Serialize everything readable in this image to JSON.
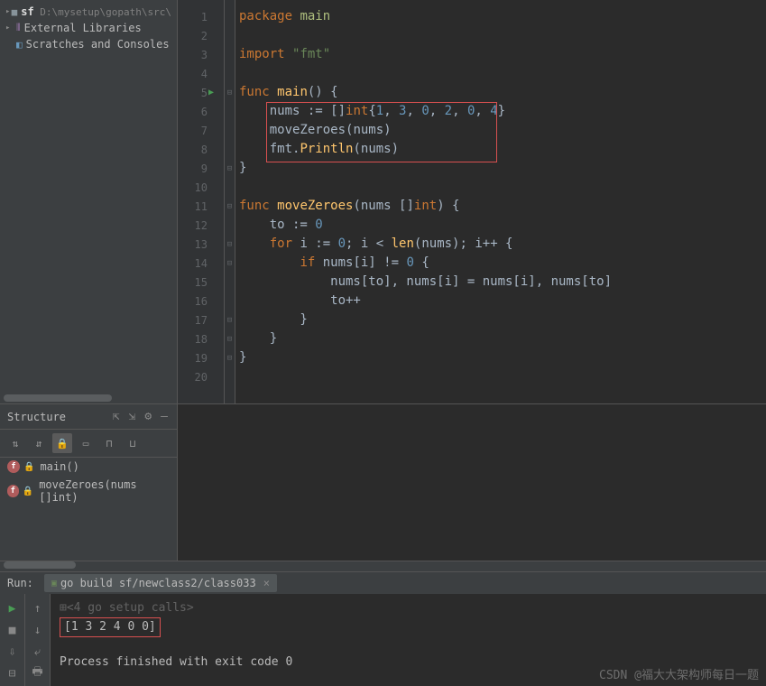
{
  "sidebar": {
    "folder": {
      "name": "sf",
      "path": "D:\\mysetup\\gopath\\src\\"
    },
    "libs": "External Libraries",
    "scratches": "Scratches and Consoles"
  },
  "code": {
    "lines": [
      {
        "n": 1,
        "segs": [
          [
            "kw",
            "package "
          ],
          [
            "pkg",
            "main"
          ]
        ]
      },
      {
        "n": 2,
        "segs": []
      },
      {
        "n": 3,
        "segs": [
          [
            "kw",
            "import "
          ],
          [
            "str",
            "\"fmt\""
          ]
        ]
      },
      {
        "n": 4,
        "segs": []
      },
      {
        "n": 5,
        "run": true,
        "fold": "⊟",
        "segs": [
          [
            "kw",
            "func "
          ],
          [
            "fn",
            "main"
          ],
          [
            "var",
            "() {"
          ]
        ]
      },
      {
        "n": 6,
        "segs": [
          [
            "var",
            "    nums := []"
          ],
          [
            "typ",
            "int"
          ],
          [
            "var",
            "{"
          ],
          [
            "num",
            "1"
          ],
          [
            "var",
            ", "
          ],
          [
            "num",
            "3"
          ],
          [
            "var",
            ", "
          ],
          [
            "num",
            "0"
          ],
          [
            "var",
            ", "
          ],
          [
            "num",
            "2"
          ],
          [
            "var",
            ", "
          ],
          [
            "num",
            "0"
          ],
          [
            "var",
            ", "
          ],
          [
            "num",
            "4"
          ],
          [
            "var",
            "}"
          ]
        ]
      },
      {
        "n": 7,
        "segs": [
          [
            "var",
            "    moveZeroes("
          ],
          [
            "var",
            "nums"
          ],
          [
            "var",
            ")"
          ]
        ]
      },
      {
        "n": 8,
        "segs": [
          [
            "var",
            "    fmt."
          ],
          [
            "fn",
            "Println"
          ],
          [
            "var",
            "("
          ],
          [
            "var",
            "nums"
          ],
          [
            "var",
            ")"
          ]
        ]
      },
      {
        "n": 9,
        "fold": "⊟",
        "segs": [
          [
            "var",
            "}"
          ]
        ]
      },
      {
        "n": 10,
        "segs": []
      },
      {
        "n": 11,
        "fold": "⊟",
        "segs": [
          [
            "kw",
            "func "
          ],
          [
            "fn",
            "moveZeroes"
          ],
          [
            "var",
            "(nums []"
          ],
          [
            "typ",
            "int"
          ],
          [
            "var",
            ") {"
          ]
        ]
      },
      {
        "n": 12,
        "segs": [
          [
            "var",
            "    to := "
          ],
          [
            "num",
            "0"
          ]
        ]
      },
      {
        "n": 13,
        "fold": "⊟",
        "segs": [
          [
            "var",
            "    "
          ],
          [
            "kw",
            "for"
          ],
          [
            "var",
            " i := "
          ],
          [
            "num",
            "0"
          ],
          [
            "var",
            "; i < "
          ],
          [
            "fn",
            "len"
          ],
          [
            "var",
            "(nums); i++ {"
          ]
        ]
      },
      {
        "n": 14,
        "fold": "⊟",
        "segs": [
          [
            "var",
            "        "
          ],
          [
            "kw",
            "if"
          ],
          [
            "var",
            " nums[i] != "
          ],
          [
            "num",
            "0"
          ],
          [
            "var",
            " {"
          ]
        ]
      },
      {
        "n": 15,
        "segs": [
          [
            "var",
            "            nums[to], nums[i] = nums[i], nums[to]"
          ]
        ]
      },
      {
        "n": 16,
        "segs": [
          [
            "var",
            "            to++"
          ]
        ]
      },
      {
        "n": 17,
        "fold": "⊟",
        "segs": [
          [
            "var",
            "        }"
          ]
        ]
      },
      {
        "n": 18,
        "fold": "⊟",
        "segs": [
          [
            "var",
            "    }"
          ]
        ]
      },
      {
        "n": 19,
        "fold": "⊟",
        "segs": [
          [
            "var",
            "}"
          ]
        ]
      },
      {
        "n": 20,
        "segs": []
      }
    ]
  },
  "structure": {
    "title": "Structure",
    "items": [
      {
        "label": "main()"
      },
      {
        "label": "moveZeroes(nums []int)"
      }
    ]
  },
  "run": {
    "title": "Run:",
    "tab": "go build sf/newclass2/class033",
    "setup": "<4 go setup calls>",
    "result": "[1 3 2 4 0 0]",
    "exit": "Process finished with exit code 0"
  },
  "watermark": "CSDN @福大大架构师每日一题"
}
